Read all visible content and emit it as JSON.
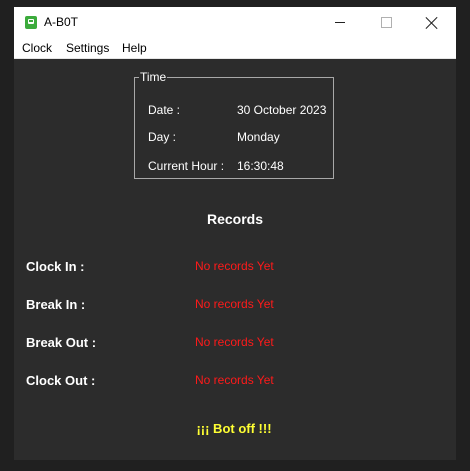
{
  "window": {
    "title": "A-B0T",
    "colors": {
      "background": "#2c2c2c",
      "titlebar": "#ffffff",
      "accent_icon": "#3cab3c"
    }
  },
  "menu": {
    "items": [
      "Clock",
      "Settings",
      "Help"
    ]
  },
  "time_group": {
    "legend": "Time",
    "rows": [
      {
        "label": "Date :",
        "value": "30 October 2023"
      },
      {
        "label": "Day :",
        "value": "Monday"
      },
      {
        "label": "Current Hour :",
        "value": "16:30:48"
      }
    ]
  },
  "records": {
    "heading": "Records",
    "rows": [
      {
        "label": "Clock In :",
        "value": "No records Yet"
      },
      {
        "label": "Break In :",
        "value": "No records Yet"
      },
      {
        "label": "Break Out :",
        "value": "No records Yet"
      },
      {
        "label": "Clock Out :",
        "value": "No records Yet"
      }
    ],
    "value_color": "#ff1a1a"
  },
  "status": {
    "text": "¡¡¡ Bot off !!!",
    "color": "#ffff33"
  }
}
